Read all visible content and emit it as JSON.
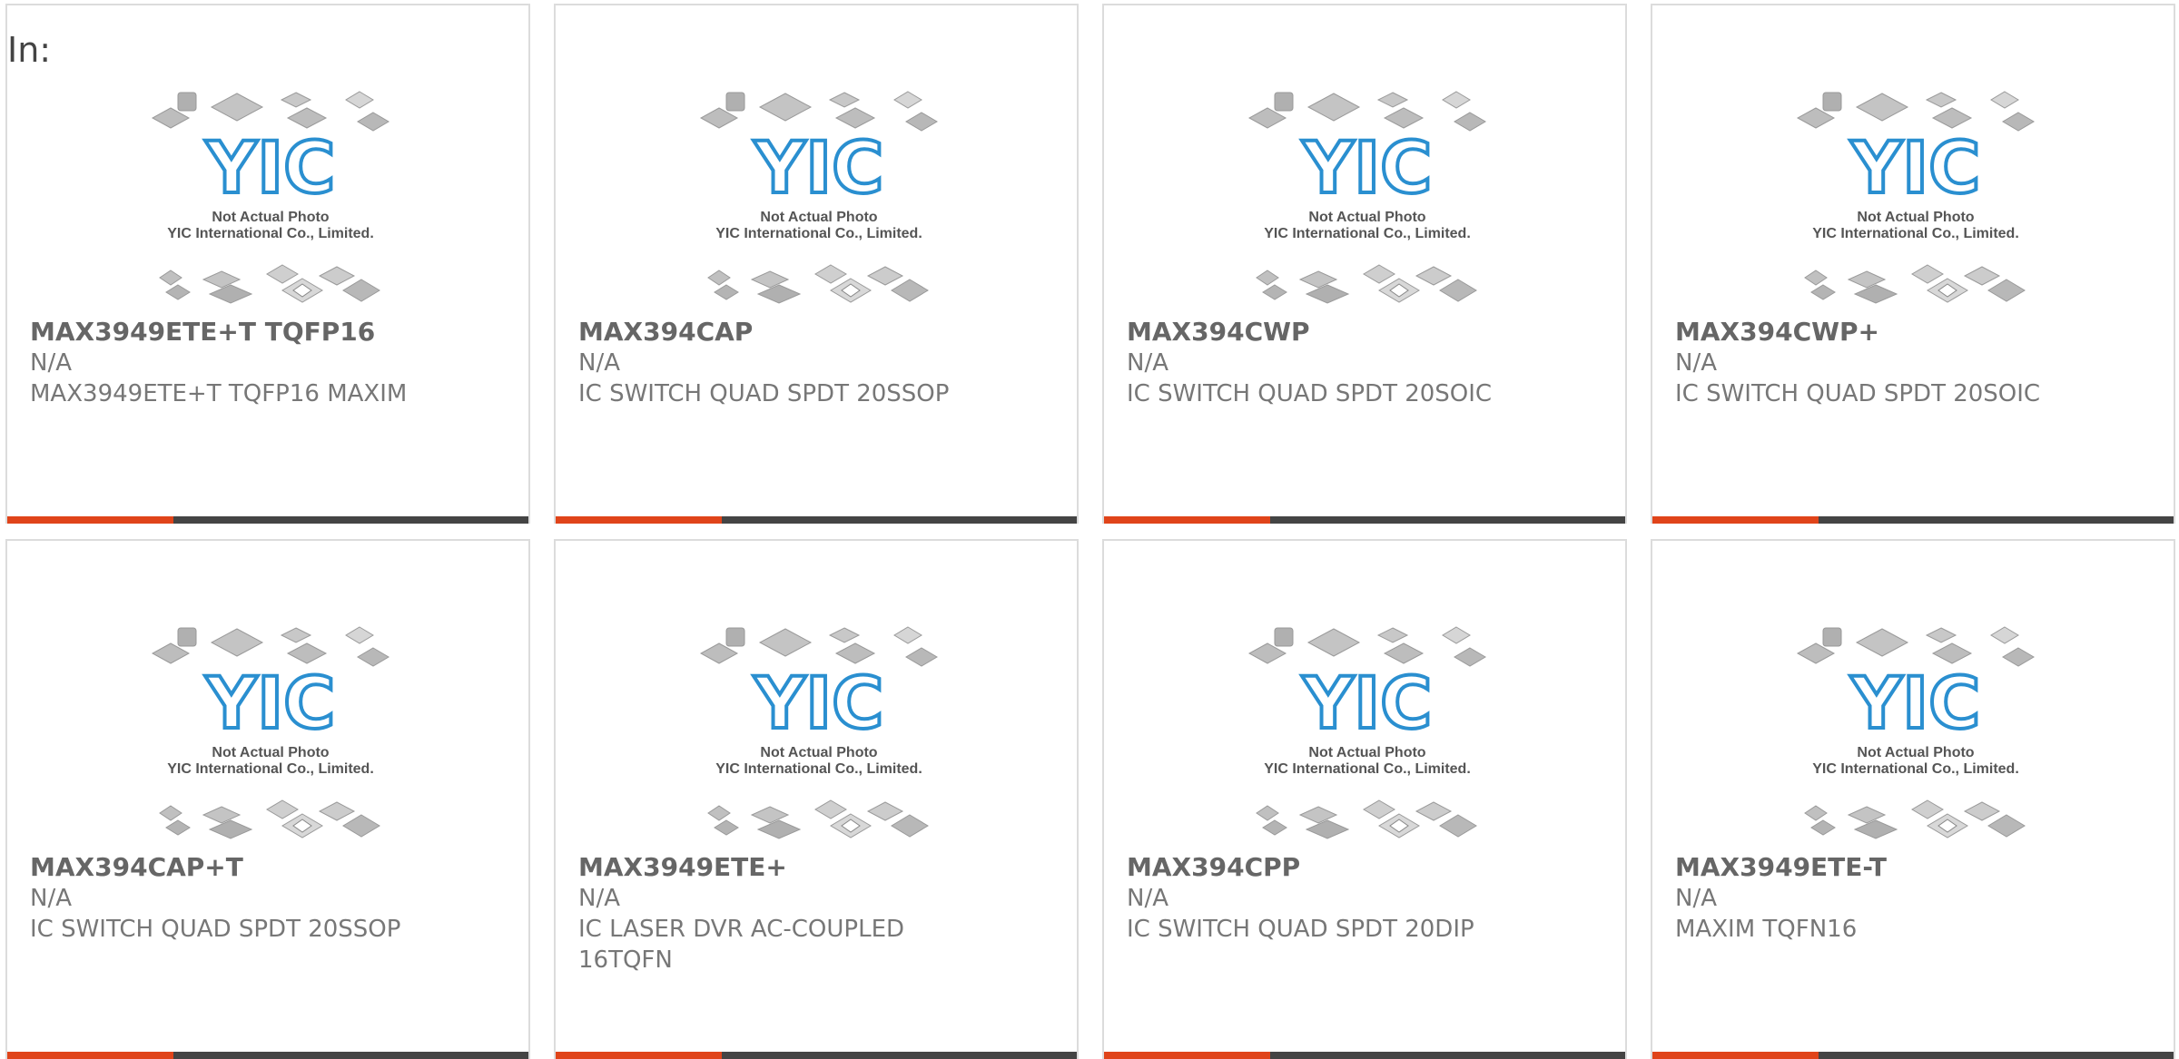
{
  "header": {
    "label": "In:"
  },
  "photo": {
    "caption1": "Not Actual Photo",
    "caption2": "YIC International Co., Limited.",
    "logo": "YIC"
  },
  "colors": {
    "accent": "#e0441a",
    "bar": "#444444",
    "logo_blue": "#2a8fd0"
  },
  "products": [
    {
      "part": "MAX3949ETE+T TQFP16",
      "mfr": "N/A",
      "desc": "MAX3949ETE+T TQFP16 MAXIM"
    },
    {
      "part": "MAX394CAP",
      "mfr": "N/A",
      "desc": "IC SWITCH QUAD SPDT 20SSOP"
    },
    {
      "part": "MAX394CWP",
      "mfr": "N/A",
      "desc": "IC SWITCH QUAD SPDT 20SOIC"
    },
    {
      "part": "MAX394CWP+",
      "mfr": "N/A",
      "desc": "IC SWITCH QUAD SPDT 20SOIC"
    },
    {
      "part": "MAX394CAP+T",
      "mfr": "N/A",
      "desc": "IC SWITCH QUAD SPDT 20SSOP"
    },
    {
      "part": "MAX3949ETE+",
      "mfr": "N/A",
      "desc": "IC LASER DVR AC-COUPLED 16TQFN"
    },
    {
      "part": "MAX394CPP",
      "mfr": "N/A",
      "desc": "IC SWITCH QUAD SPDT 20DIP"
    },
    {
      "part": "MAX3949ETE-T",
      "mfr": "N/A",
      "desc": "MAXIM TQFN16"
    }
  ]
}
